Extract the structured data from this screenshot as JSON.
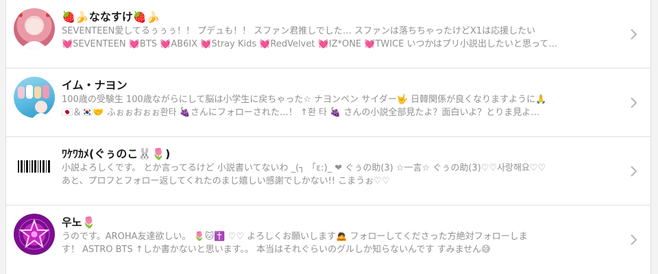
{
  "users": [
    {
      "name": "🍓🍌ななすけ🍓🍌",
      "bio_line1": "SEVENTEEN愛してるぅぅぅ！！ プデュも！！ スファン君推しでした… スファンは落ちちゃったけどX1は応援したい",
      "bio_line2": "💓SEVENTEEN 💓BTS 💓AB6IX 💓Stray Kids 💓RedVelvet 💓IZ*ONE 💓TWICE いつかはプリ小説出したいと思って…",
      "avatar_icon": "profile-photo"
    },
    {
      "name": "イム・ナヨン",
      "bio_line1": "100歳の受験生 100歳ながらにして脳は小学生に戻ちゃった☆ ナヨンペン サイダー🤟 日韓関係が良くなりますように🙏",
      "bio_line2": "🇯🇵＆🇰🇷🤝 ふぉぉおぉぉ환타 🍇さんにフォローされた…！ ↑환 타 🍇 さんの小説全部見たよ？面白いよ？とりま見よ…",
      "avatar_icon": "group-photo"
    },
    {
      "name": "ﾜｹﾜｶﾒ(ぐぅのこ🐰🌷)",
      "bio_line1": "小説よろしくです。 とか言ってるけど 小説書いてないわ _(┐ 「ε:)_ ❤ ぐぅの助(3) ☆一言☆ ぐぅの助(3)♡♡사랑해요♡♡",
      "bio_line2": "あと、プロフとフォロー返してくれたのまじ嬉しい感謝でしかない!! こまうぉ♡♡",
      "avatar_icon": "barcode"
    },
    {
      "name": "우노🌷",
      "bio_line1": "うのです。AROHA友達欲しい。 🌷🐱✝️ ♡♡ よろしくお願いします🙇 フォローしてくださった方絶対フォローしま",
      "bio_line2": "す！ ASTRO BTS ↑しか書かないと思います。。 本当はそれぐらいのグルしか知らないんです すみません😅",
      "avatar_icon": "neon-star"
    }
  ],
  "chevron_icon": "chevron-right-icon",
  "colors": {
    "name": "#1c1c1c",
    "bio": "#909090",
    "divider": "#dedede",
    "chevron": "#b5b5b5"
  }
}
